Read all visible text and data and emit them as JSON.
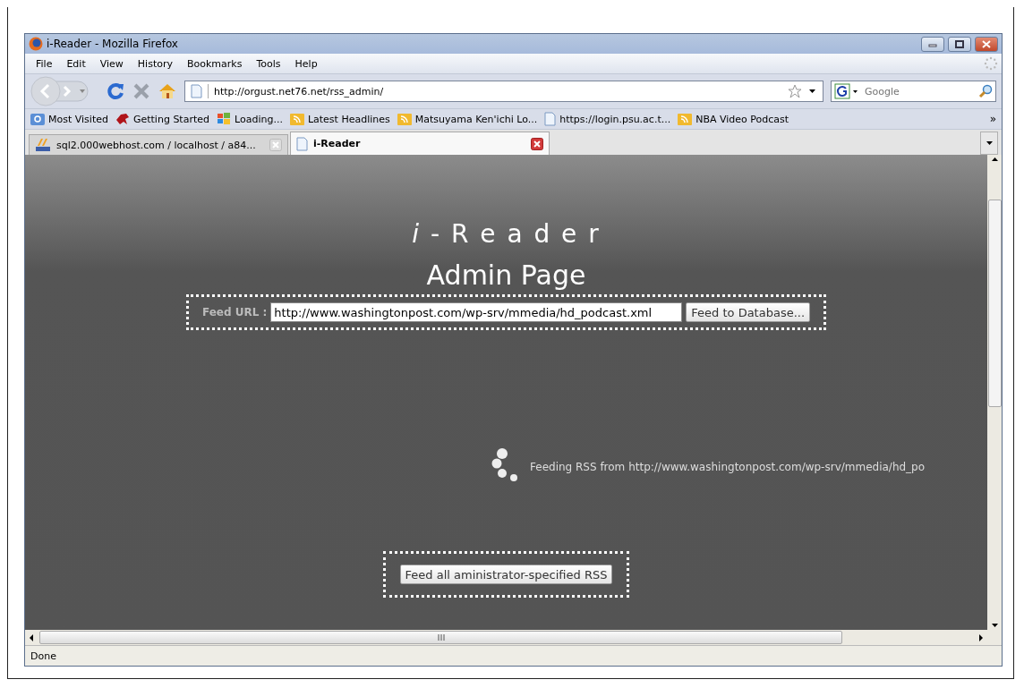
{
  "window": {
    "title": "i-Reader - Mozilla Firefox"
  },
  "menu": [
    "File",
    "Edit",
    "View",
    "History",
    "Bookmarks",
    "Tools",
    "Help"
  ],
  "navigation": {
    "url": "http://orgust.net76.net/rss_admin/",
    "search_placeholder": "Google"
  },
  "bookmarks": [
    {
      "kind": "smart",
      "label": "Most Visited"
    },
    {
      "kind": "dino",
      "label": "Getting Started"
    },
    {
      "kind": "windows",
      "label": "Loading..."
    },
    {
      "kind": "feed",
      "label": "Latest Headlines"
    },
    {
      "kind": "feed",
      "label": "Matsuyama Ken'ichi Lo..."
    },
    {
      "kind": "page",
      "label": "https://login.psu.ac.t..."
    },
    {
      "kind": "feed",
      "label": "NBA Video Podcast"
    }
  ],
  "overflow": "»",
  "tabs": [
    {
      "label": "sql2.000webhost.com / localhost / a84...",
      "selected": false,
      "kind": "pma"
    },
    {
      "label": "i-Reader",
      "selected": true,
      "kind": "page"
    }
  ],
  "page": {
    "logo": "*i* - R e a d e r",
    "heading": "Admin Page",
    "feed_label": "Feed URL :",
    "feed_url": "http://www.washingtonpost.com/wp-srv/mmedia/hd_podcast.xml",
    "feed_button": "Feed to Database...",
    "status": "Feeding RSS from http://www.washingtonpost.com/wp-srv/mmedia/hd_po",
    "feed_all_button": "Feed all aministrator-specified RSS"
  },
  "status_bar": "Done"
}
